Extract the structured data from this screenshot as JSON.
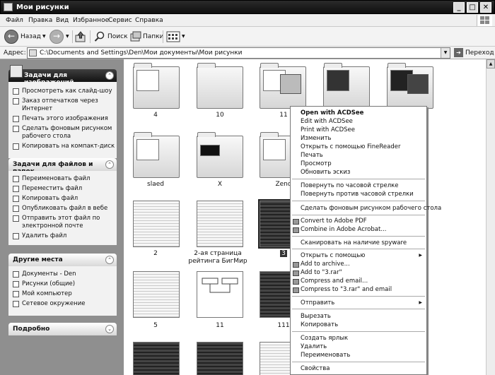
{
  "window": {
    "title": "Мои рисунки"
  },
  "menu": [
    "Файл",
    "Правка",
    "Вид",
    "Избранное",
    "Сервис",
    "Справка"
  ],
  "toolbar": {
    "back": "Назад",
    "search": "Поиск",
    "folders": "Папки"
  },
  "address": {
    "label": "Адрес:",
    "path": "C:\\Documents and Settings\\Den\\Мои документы\\Мои рисунки",
    "go": "Переход"
  },
  "left": {
    "image_tasks": {
      "title": "Задачи для изображений",
      "items": [
        "Просмотреть как слайд-шоу",
        "Заказ отпечатков через Интернет",
        "Печать этого изображения",
        "Сделать фоновым рисунком рабочего стола",
        "Копировать на компакт-диск"
      ]
    },
    "file_tasks": {
      "title": "Задачи для файлов и папок",
      "items": [
        "Переименовать файл",
        "Переместить файл",
        "Копировать файл",
        "Опубликовать файл в вебе",
        "Отправить этот файл по электронной почте",
        "Удалить файл"
      ]
    },
    "other_places": {
      "title": "Другие места",
      "items": [
        "Документы - Den",
        "Рисунки (общие)",
        "Мой компьютер",
        "Сетевое окружение"
      ]
    },
    "details": {
      "title": "Подробно"
    }
  },
  "thumbs": {
    "r1": [
      "4",
      "10",
      "11"
    ],
    "r2": [
      "slaed",
      "X",
      "Zend"
    ],
    "r3": [
      "2",
      "2-ая страница рейтинга БигМир",
      "3"
    ],
    "r4": [
      "5",
      "11",
      "111"
    ]
  },
  "context_menu": {
    "open_acdsee": "Open with ACDSee",
    "edit_acdsee": "Edit with ACDSee",
    "print_acdsee": "Print with ACDSee",
    "change": "Изменить",
    "open_finereader": "Открыть с помощью FineReader",
    "print": "Печать",
    "preview": "Просмотр",
    "refresh_thumb": "Обновить эскиз",
    "rotate_cw": "Повернуть по часовой стрелке",
    "rotate_ccw": "Повернуть против часовой стрелки",
    "set_wallpaper": "Сделать фоновым рисунком рабочего стола",
    "convert_pdf": "Convert to Adobe PDF",
    "combine_acrobat": "Combine in Adobe Acrobat...",
    "scan_spyware": "Сканировать на наличие spyware",
    "open_with": "Открыть с помощью",
    "add_archive": "Add to archive...",
    "add_rar": "Add to \"3.rar\"",
    "compress_email": "Compress and email...",
    "compress_rar_email": "Compress to \"3.rar\" and email",
    "send_to": "Отправить",
    "cut": "Вырезать",
    "copy": "Копировать",
    "create_shortcut": "Создать ярлык",
    "delete": "Удалить",
    "rename": "Переименовать",
    "properties": "Свойства"
  }
}
